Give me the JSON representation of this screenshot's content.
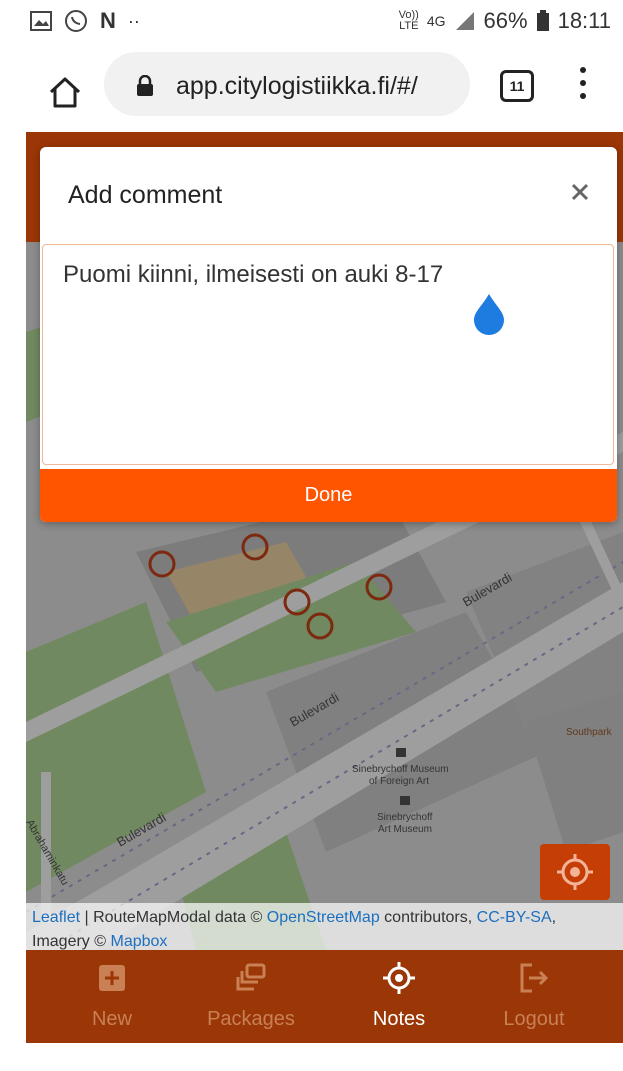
{
  "status_bar": {
    "icons": [
      "image-icon",
      "whatsapp-icon",
      "netflix-icon",
      "more-dots-icon"
    ],
    "network_volte": "Vo))",
    "network_lte": "LTE",
    "network_type": "4G",
    "battery": "66%",
    "time": "18:11"
  },
  "browser": {
    "url": "app.citylogistiikka.fi/#/",
    "tab_count": "11"
  },
  "modal": {
    "title": "Add comment",
    "comment_text": "Puomi kiinni, ilmeisesti on auki 8-17",
    "done_label": "Done"
  },
  "map": {
    "labels": {
      "bulevardi": "Bulevardi",
      "abrahamink": "Abrahaminkatu",
      "museum_foreign": "Sinebrychoff Museum",
      "museum_foreign_2": "of Foreign Art",
      "museum_art": "Sinebrychoff",
      "museum_art_2": "Art Museum",
      "southpark": "Southpark"
    },
    "attribution": {
      "leaflet": "Leaflet",
      "sep1": " | RouteMapModal data © ",
      "osm": "OpenStreetMap",
      "contrib": " contributors, ",
      "license": "CC-BY-SA",
      "imagery": ", Imagery © ",
      "mapbox": "Mapbox"
    }
  },
  "nav": {
    "new": "New",
    "packages": "Packages",
    "notes": "Notes",
    "logout": "Logout"
  },
  "colors": {
    "brand_dark": "#9b3606",
    "accent": "#ff5500",
    "link": "#1d6fbf"
  }
}
